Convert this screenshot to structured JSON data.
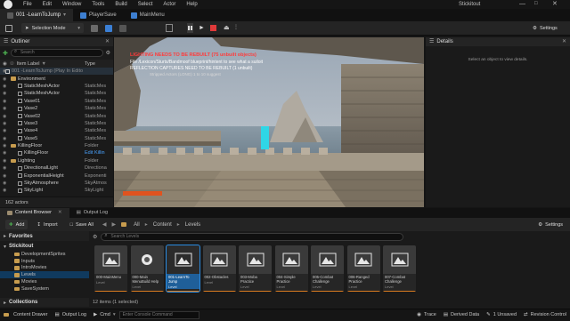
{
  "menu": {
    "items": [
      "File",
      "Edit",
      "Window",
      "Tools",
      "Build",
      "Select",
      "Actor",
      "Help"
    ],
    "project": "001 -LearnToJump",
    "project_chevron": "chevron-down-icon",
    "stickitout": "Stickitout"
  },
  "tabs": [
    {
      "label": "PlayerSave"
    },
    {
      "label": "MainMenu"
    }
  ],
  "toolbar": {
    "selection_mode": "Selection Mode",
    "settings": "Settings"
  },
  "outliner": {
    "title": "Outliner",
    "search_placeholder": "Search",
    "col_item": "Item Label",
    "col_type": "Type",
    "sort_arrow": "▼",
    "rows": [
      {
        "name": "001 -LearnToJump (Play In Edito",
        "type": "",
        "kind": "root"
      },
      {
        "name": "Environment",
        "type": "",
        "kind": "folder"
      },
      {
        "name": "StaticMeshActor",
        "type": "StaticMes",
        "kind": "mesh"
      },
      {
        "name": "StaticMeshActor",
        "type": "StaticMes",
        "kind": "mesh"
      },
      {
        "name": "Vase01",
        "type": "StaticMes",
        "kind": "mesh"
      },
      {
        "name": "Vase2",
        "type": "StaticMes",
        "kind": "mesh"
      },
      {
        "name": "Vase02",
        "type": "StaticMes",
        "kind": "mesh"
      },
      {
        "name": "Vase3",
        "type": "StaticMes",
        "kind": "mesh"
      },
      {
        "name": "Vase4",
        "type": "StaticMes",
        "kind": "mesh"
      },
      {
        "name": "Vase5",
        "type": "StaticMes",
        "kind": "mesh"
      },
      {
        "name": "KillingFloor",
        "type": "Folder",
        "kind": "folder"
      },
      {
        "name": "KillingFloor",
        "type": "Edit Killin",
        "kind": "mesh"
      },
      {
        "name": "Lighting",
        "type": "Folder",
        "kind": "folder"
      },
      {
        "name": "DirectionalLight",
        "type": "Directiona",
        "kind": "mesh"
      },
      {
        "name": "ExponentialHeight",
        "type": "Exponenti",
        "kind": "mesh"
      },
      {
        "name": "SkyAtmosphere",
        "type": "SkyAtmos",
        "kind": "mesh"
      },
      {
        "name": "SkyLight",
        "type": "SkyLight",
        "kind": "mesh"
      }
    ],
    "count": "162 actors"
  },
  "viewport": {
    "warning": "LIGHTING NEEDS TO BE REBUILT (75 unbuilt objects)",
    "line2": "File /Lexicon/Sturts/Bandmoof blueprint/hintent to see what a suiloit",
    "line3": "REFLECTION CAPTURES NEED TO BE REBUILT (1 unbuilt)",
    "line4": "Stripped.Actors (LONG) 1 to 10 suggest"
  },
  "details": {
    "title": "Details",
    "hint": "Select an object to view details."
  },
  "content_browser": {
    "tab1": "Content Browser",
    "tab2": "Output Log",
    "add": "Add",
    "import": "Import",
    "save_all": "Save All",
    "path": [
      "All",
      "Content",
      "Levels"
    ],
    "settings": "Settings",
    "search_placeholder": "Search Levels",
    "favorites": "Favorites",
    "root": "Stickitout",
    "tree": [
      "DevelopmentSprites",
      "Inputs",
      "IntroMovies",
      "Levels",
      "Movies",
      "SaveSystem"
    ],
    "collections": "Collections",
    "items_info": "12 items (1 selected)",
    "tiles": [
      {
        "name": "000-MainMenu",
        "kind": "Level"
      },
      {
        "name": "000-Main MenuBuild Help",
        "kind": "Level"
      },
      {
        "name": "001-LearnTo Jump",
        "kind": "Level"
      },
      {
        "name": "002-Obstacles",
        "kind": "Level"
      },
      {
        "name": "003-Moba Practice",
        "kind": "Level"
      },
      {
        "name": "004-Simple Practice",
        "kind": "Level"
      },
      {
        "name": "005-Combat Challenge",
        "kind": "Level"
      },
      {
        "name": "006-Ranged Practice",
        "kind": "Level"
      },
      {
        "name": "007-Combat Challenge",
        "kind": "Level"
      }
    ]
  },
  "status": {
    "content_drawer": "Content Drawer",
    "output_log": "Output Log",
    "cmd": "Cmd",
    "console_placeholder": "Enter Console Command",
    "trace": "Trace",
    "derived_data": "Derived Data",
    "unsaved": "1 Unsaved",
    "revision_control": "Revision Control"
  },
  "colors": {
    "accent": "#2a8be0",
    "warning": "#e03a3a",
    "selection": "#103a5e"
  }
}
